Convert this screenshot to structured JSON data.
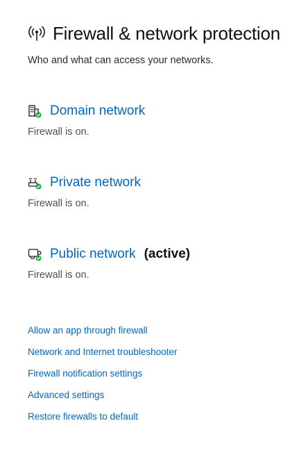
{
  "header": {
    "title": "Firewall & network protection",
    "subtitle": "Who and what can access your networks.",
    "icon": "broadcast-antenna-icon"
  },
  "networks": [
    {
      "label": "Domain network",
      "active_label": "",
      "status": "Firewall is on.",
      "icon": "domain-building-icon"
    },
    {
      "label": "Private network",
      "active_label": "",
      "status": "Firewall is on.",
      "icon": "private-network-icon"
    },
    {
      "label": "Public network",
      "active_label": "(active)",
      "status": "Firewall is on.",
      "icon": "public-network-icon"
    }
  ],
  "links": [
    "Allow an app through firewall",
    "Network and Internet troubleshooter",
    "Firewall notification settings",
    "Advanced settings",
    "Restore firewalls to default"
  ],
  "colors": {
    "link": "#0067c0",
    "check_badge": "#16a34a",
    "text": "#1a1a1a"
  }
}
